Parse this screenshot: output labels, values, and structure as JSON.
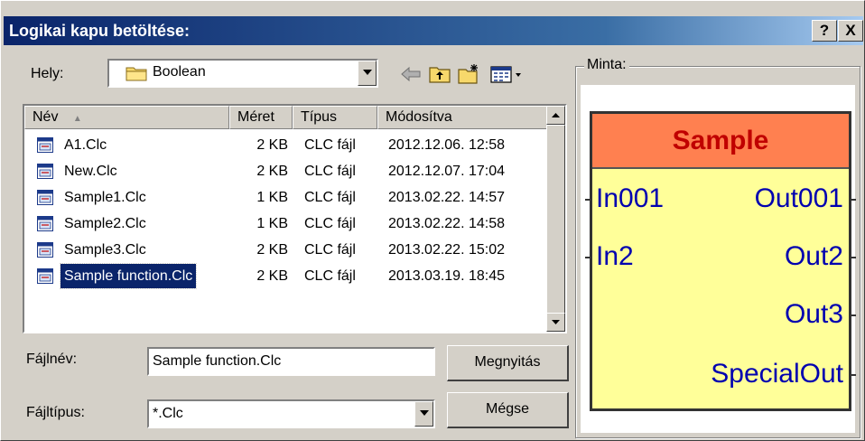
{
  "window": {
    "title": "Logikai kapu betöltése:",
    "help_label": "?",
    "close_label": "X"
  },
  "location": {
    "label": "Hely:",
    "folder": "Boolean",
    "folder_icon": "folder-icon"
  },
  "toolbar": {
    "back_icon": "back-arrow-icon",
    "up_icon": "up-folder-icon",
    "new_folder_icon": "new-folder-icon",
    "view_menu_icon": "view-menu-icon"
  },
  "file_list": {
    "columns": [
      "Név",
      "Méret",
      "Típus",
      "Módosítva"
    ],
    "sort_indicator": "▲",
    "rows": [
      {
        "name": "A1.Clc",
        "size": "2 KB",
        "type": "CLC fájl",
        "modified": "2012.12.06. 12:58"
      },
      {
        "name": "New.Clc",
        "size": "2 KB",
        "type": "CLC fájl",
        "modified": "2012.12.07. 17:04"
      },
      {
        "name": "Sample1.Clc",
        "size": "1 KB",
        "type": "CLC fájl",
        "modified": "2013.02.22. 14:57"
      },
      {
        "name": "Sample2.Clc",
        "size": "1 KB",
        "type": "CLC fájl",
        "modified": "2013.02.22. 14:58"
      },
      {
        "name": "Sample3.Clc",
        "size": "2 KB",
        "type": "CLC fájl",
        "modified": "2013.02.22. 15:02"
      },
      {
        "name": "Sample function.Clc",
        "size": "2 KB",
        "type": "CLC fájl",
        "modified": "2013.03.19. 18:45"
      }
    ],
    "selected_index": 5
  },
  "filename": {
    "label": "Fájlnév:",
    "value": "Sample function.Clc"
  },
  "filetype": {
    "label": "Fájltípus:",
    "value": "*.Clc"
  },
  "buttons": {
    "open": "Megnyitás",
    "cancel": "Mégse"
  },
  "preview": {
    "label": "Minta:",
    "gate_title": "Sample",
    "inputs": [
      "In001",
      "In2"
    ],
    "outputs": [
      "Out001",
      "Out2",
      "Out3",
      "SpecialOut"
    ],
    "colors": {
      "header_bg": "#ff8050",
      "header_text": "#c00000",
      "body_bg": "#ffff99",
      "pin_text": "#0000b0"
    }
  },
  "colors": {
    "titlebar_start": "#0a246a",
    "titlebar_end": "#a6caf0",
    "selection": "#0a246a",
    "dialog_bg": "#d4d0c8"
  }
}
